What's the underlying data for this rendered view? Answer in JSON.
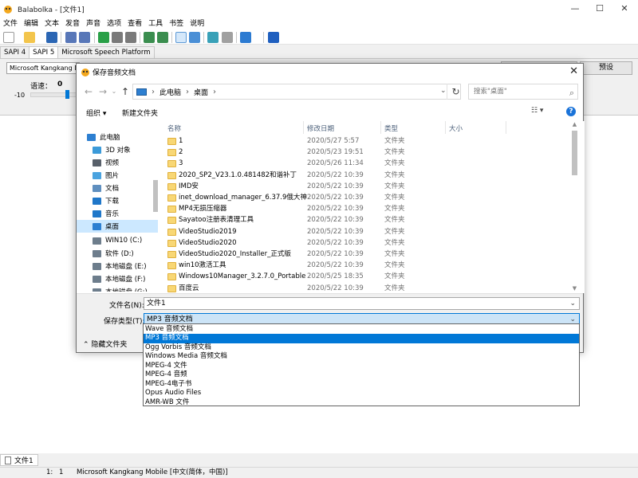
{
  "app": {
    "title": "Balabolka - [文件1]",
    "menu": [
      "文件",
      "编辑",
      "文本",
      "发音",
      "声音",
      "选项",
      "查看",
      "工具",
      "书签",
      "说明"
    ],
    "sapi_tabs": [
      "SAPI 4",
      "SAPI 5",
      "Microsoft Speech Platform"
    ],
    "voice": "Microsoft Kangkang Mobile",
    "settings_label": "预设",
    "rate_label": "语速：",
    "rate_value": "0",
    "rate_min": "-10",
    "doc_tab": "文件1",
    "status": {
      "position_line": "1:",
      "position_col": "1",
      "voice_info": "Microsoft Kangkang Mobile [中文(简体，中国)]"
    },
    "window_controls": {
      "minimize": "—",
      "maximize": "☐",
      "close": "✕"
    }
  },
  "dialog": {
    "title": "保存音频文档",
    "close": "✕",
    "breadcrumb": [
      "此电脑",
      "桌面"
    ],
    "search_placeholder": "搜索\"桌面\"",
    "organize_label": "组织 ▾",
    "new_folder_label": "新建文件夹",
    "nav_tree": [
      {
        "label": "此电脑",
        "icon": "computer-icon",
        "color": "#2d7fd1"
      },
      {
        "label": "3D 对象",
        "icon": "3d-objects-icon",
        "color": "#3b9ad9"
      },
      {
        "label": "视频",
        "icon": "video-icon",
        "color": "#58606a"
      },
      {
        "label": "图片",
        "icon": "pictures-icon",
        "color": "#4aa3df"
      },
      {
        "label": "文档",
        "icon": "documents-icon",
        "color": "#5f8fbf"
      },
      {
        "label": "下载",
        "icon": "download-icon",
        "color": "#1f77c9"
      },
      {
        "label": "音乐",
        "icon": "music-icon",
        "color": "#1f77c9"
      },
      {
        "label": "桌面",
        "icon": "desktop-icon",
        "color": "#2d7fd1"
      },
      {
        "label": "WIN10 (C:)",
        "icon": "drive-c-icon",
        "color": "#6d7d8c"
      },
      {
        "label": "软件 (D:)",
        "icon": "drive-icon",
        "color": "#6d7d8c"
      },
      {
        "label": "本地磁盘 (E:)",
        "icon": "drive-icon",
        "color": "#6d7d8c"
      },
      {
        "label": "本地磁盘 (F:)",
        "icon": "drive-icon",
        "color": "#6d7d8c"
      },
      {
        "label": "本地磁盘 (G:)",
        "icon": "drive-icon",
        "color": "#6d7d8c"
      }
    ],
    "columns": [
      "名称",
      "修改日期",
      "类型",
      "大小"
    ],
    "files": [
      {
        "name": "1",
        "date": "2020/5/27 5:57",
        "type": "文件夹"
      },
      {
        "name": "2",
        "date": "2020/5/23 19:51",
        "type": "文件夹"
      },
      {
        "name": "3",
        "date": "2020/5/26 11:34",
        "type": "文件夹"
      },
      {
        "name": "2020_SP2_V23.1.0.481482和谐补丁",
        "date": "2020/5/22 10:39",
        "type": "文件夹"
      },
      {
        "name": "IMD安",
        "date": "2020/5/22 10:39",
        "type": "文件夹"
      },
      {
        "name": "inet_download_manager_6.37.9俄大神",
        "date": "2020/5/22 10:39",
        "type": "文件夹"
      },
      {
        "name": "MP4无损压缩器",
        "date": "2020/5/22 10:39",
        "type": "文件夹"
      },
      {
        "name": "Sayatoo注册表清理工具",
        "date": "2020/5/22 10:39",
        "type": "文件夹"
      },
      {
        "name": "VideoStudio2019",
        "date": "2020/5/22 10:39",
        "type": "文件夹"
      },
      {
        "name": "VideoStudio2020",
        "date": "2020/5/22 10:39",
        "type": "文件夹"
      },
      {
        "name": "VideoStudio2020_Installer_正式版",
        "date": "2020/5/22 10:39",
        "type": "文件夹"
      },
      {
        "name": "win10激活工具",
        "date": "2020/5/22 10:39",
        "type": "文件夹"
      },
      {
        "name": "Windows10Manager_3.2.7.0_Portable",
        "date": "2020/5/25 18:35",
        "type": "文件夹"
      },
      {
        "name": "百度云",
        "date": "2020/5/22 10:39",
        "type": "文件夹"
      }
    ],
    "filename_label": "文件名(N):",
    "filename_value": "文件1",
    "filetype_label": "保存类型(T):",
    "filetype_value": "MP3 音频文档",
    "hide_folders_label": "隐藏文件夹",
    "type_options": [
      "Wave 音频文档",
      "MP3 音频文档",
      "Ogg Vorbis 音频文档",
      "Windows Media 音频文档",
      "MPEG-4 文件",
      "MPEG-4 音频",
      "MPEG-4电子书",
      "Opus Audio Files",
      "AMR-WB 文件"
    ],
    "selected_type_index": 1
  },
  "colors": {
    "accent": "#0078d7",
    "selection": "#cce8ff",
    "folder": "#f8d775"
  }
}
